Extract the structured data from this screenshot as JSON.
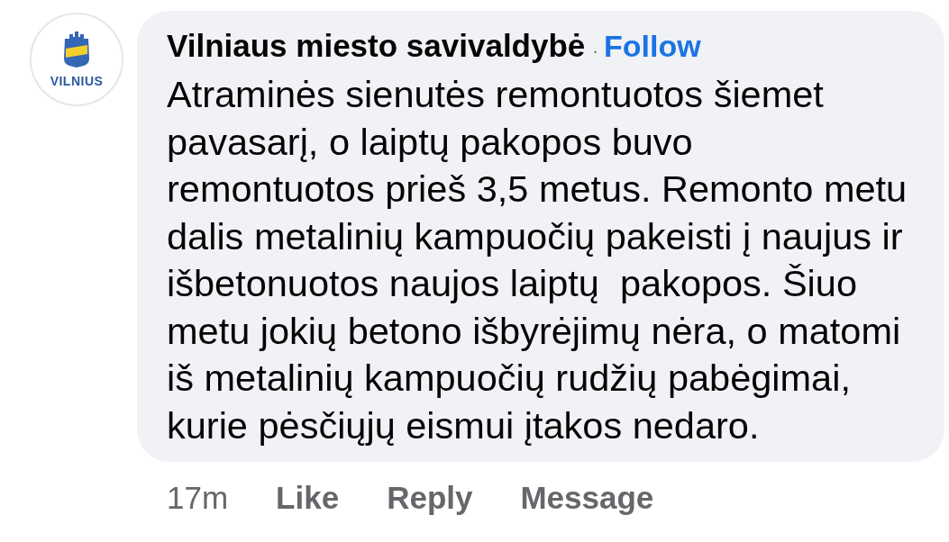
{
  "comment": {
    "avatar": {
      "logo_text": "VILNIUS"
    },
    "author": "Vilniaus miesto savivaldybė",
    "separator": "·",
    "follow": "Follow",
    "body": "Atraminės sienutės remontuotos šiemet\npavasarį, o laiptų pakopos buvo\nremontuotos prieš 3,5 metus. Remonto metu\ndalis metalinių kampuočių pakeisti į naujus ir\nišbetonuotos naujos laiptų  pakopos. Šiuo\nmetu jokių betono išbyrėjimų nėra, o matomi\niš metalinių kampuočių rudžių pabėgimai,\nkurie pėsčiųjų eismui įtakos nedaro.",
    "actions": [
      {
        "kind": "time",
        "label": "17m"
      },
      {
        "kind": "link",
        "label": "Like"
      },
      {
        "kind": "link",
        "label": "Reply"
      },
      {
        "kind": "link",
        "label": "Message"
      }
    ]
  }
}
